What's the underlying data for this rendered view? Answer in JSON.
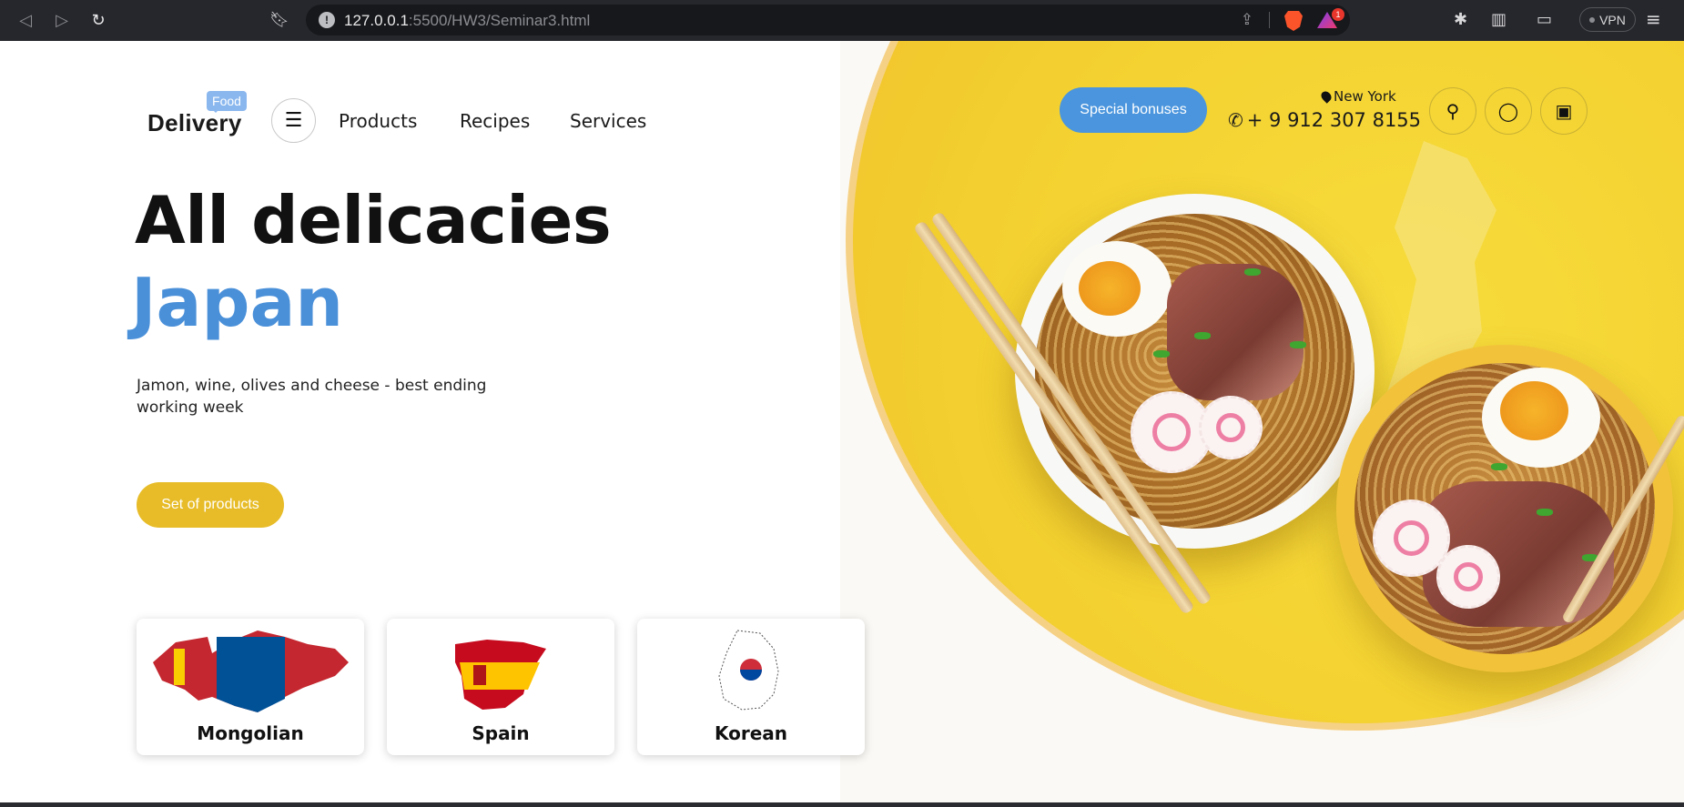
{
  "browser": {
    "url_host": "127.0.0.1",
    "url_path": ":5500/HW3/Seminar3.html",
    "vpn_label": "VPN",
    "rewards_count": "1"
  },
  "header": {
    "logo_food": "Food",
    "logo_text": "Delivery",
    "nav": [
      "Products",
      "Recipes",
      "Services"
    ],
    "special_button": "Special bonuses",
    "city": "New York",
    "phone": "+ 9 912 307 8155"
  },
  "hero": {
    "title": "All delicacies",
    "country": "Japan",
    "description": "Jamon, wine, olives and cheese - best ending working week",
    "cta": "Set of products"
  },
  "cuisines": [
    {
      "label": "Mongolian"
    },
    {
      "label": "Spain"
    },
    {
      "label": "Korean"
    }
  ],
  "colors": {
    "accent_blue": "#4a95dd",
    "accent_yellow": "#e7bc28",
    "circle_yellow": "#f3d02f"
  },
  "icons": {
    "back": "back-arrow-icon",
    "forward": "forward-arrow-icon",
    "reload": "reload-icon",
    "bookmark": "bookmark-icon",
    "search": "search-icon",
    "user": "user-icon",
    "cart": "shop-icon",
    "menu": "hamburger-icon",
    "location": "pin-icon",
    "phone": "phone-icon"
  }
}
